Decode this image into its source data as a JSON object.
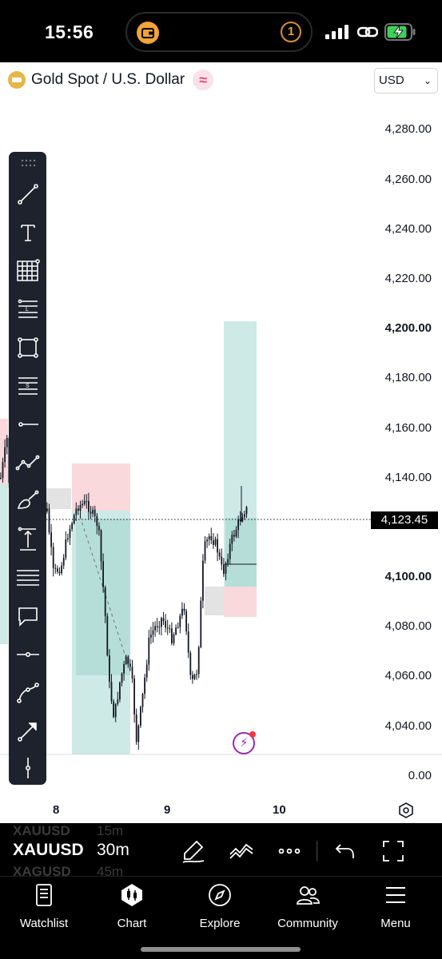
{
  "status_bar": {
    "time": "15:56",
    "badge": "1",
    "icons": [
      "wallet-icon",
      "signal-icon",
      "link-icon",
      "battery-charging-icon"
    ]
  },
  "header": {
    "title": "Gold Spot / U.S. Dollar",
    "currency": "USD"
  },
  "price_axis": {
    "labels": [
      "4,280.00",
      "4,260.00",
      "4,240.00",
      "4,220.00",
      "4,200.00",
      "4,180.00",
      "4,160.00",
      "4,140.00",
      "4,123.45",
      "4,100.00",
      "4,080.00",
      "4,060.00",
      "4,040.00",
      "0.00"
    ],
    "current_price": "4,123.45"
  },
  "time_axis": {
    "labels": [
      "8",
      "9",
      "10"
    ]
  },
  "colors": {
    "up": "#26a69a",
    "down": "#ef5350",
    "candle": "#131722",
    "long_zone": "#cdeae6",
    "short_zone": "#f9d9dc",
    "grey_zone": "#e3e3e3",
    "accent_purple": "#9c27b0",
    "toolbar_bg": "#1e222d"
  },
  "toolbar": {
    "tools": [
      "trend-line-icon",
      "text-icon",
      "gann-grid-icon",
      "fib-levels-icon",
      "rectangle-icon",
      "fib-extension-icon",
      "horizontal-ray-icon",
      "pattern-icon",
      "brush-icon",
      "measure-icon",
      "parallel-channel-icon",
      "comment-icon",
      "horizontal-line-icon",
      "path-icon",
      "arrow-icon",
      "vertical-line-icon"
    ]
  },
  "interval_bar": {
    "symbol": "XAUUSD",
    "interval": "30m",
    "ghost_symbol_above": "XAUUSD",
    "ghost_interval_above": "15m",
    "ghost_symbol_below": "XAGUSD",
    "ghost_interval_below": "45m",
    "icons": [
      "drawing-pen-icon",
      "indicators-icon",
      "more-icon",
      "undo-icon",
      "fullscreen-icon"
    ]
  },
  "tabs": [
    {
      "label": "Watchlist",
      "icon": "watchlist-icon"
    },
    {
      "label": "Chart",
      "icon": "chart-icon"
    },
    {
      "label": "Explore",
      "icon": "compass-icon"
    },
    {
      "label": "Community",
      "icon": "community-icon"
    },
    {
      "label": "Menu",
      "icon": "menu-icon"
    }
  ]
}
